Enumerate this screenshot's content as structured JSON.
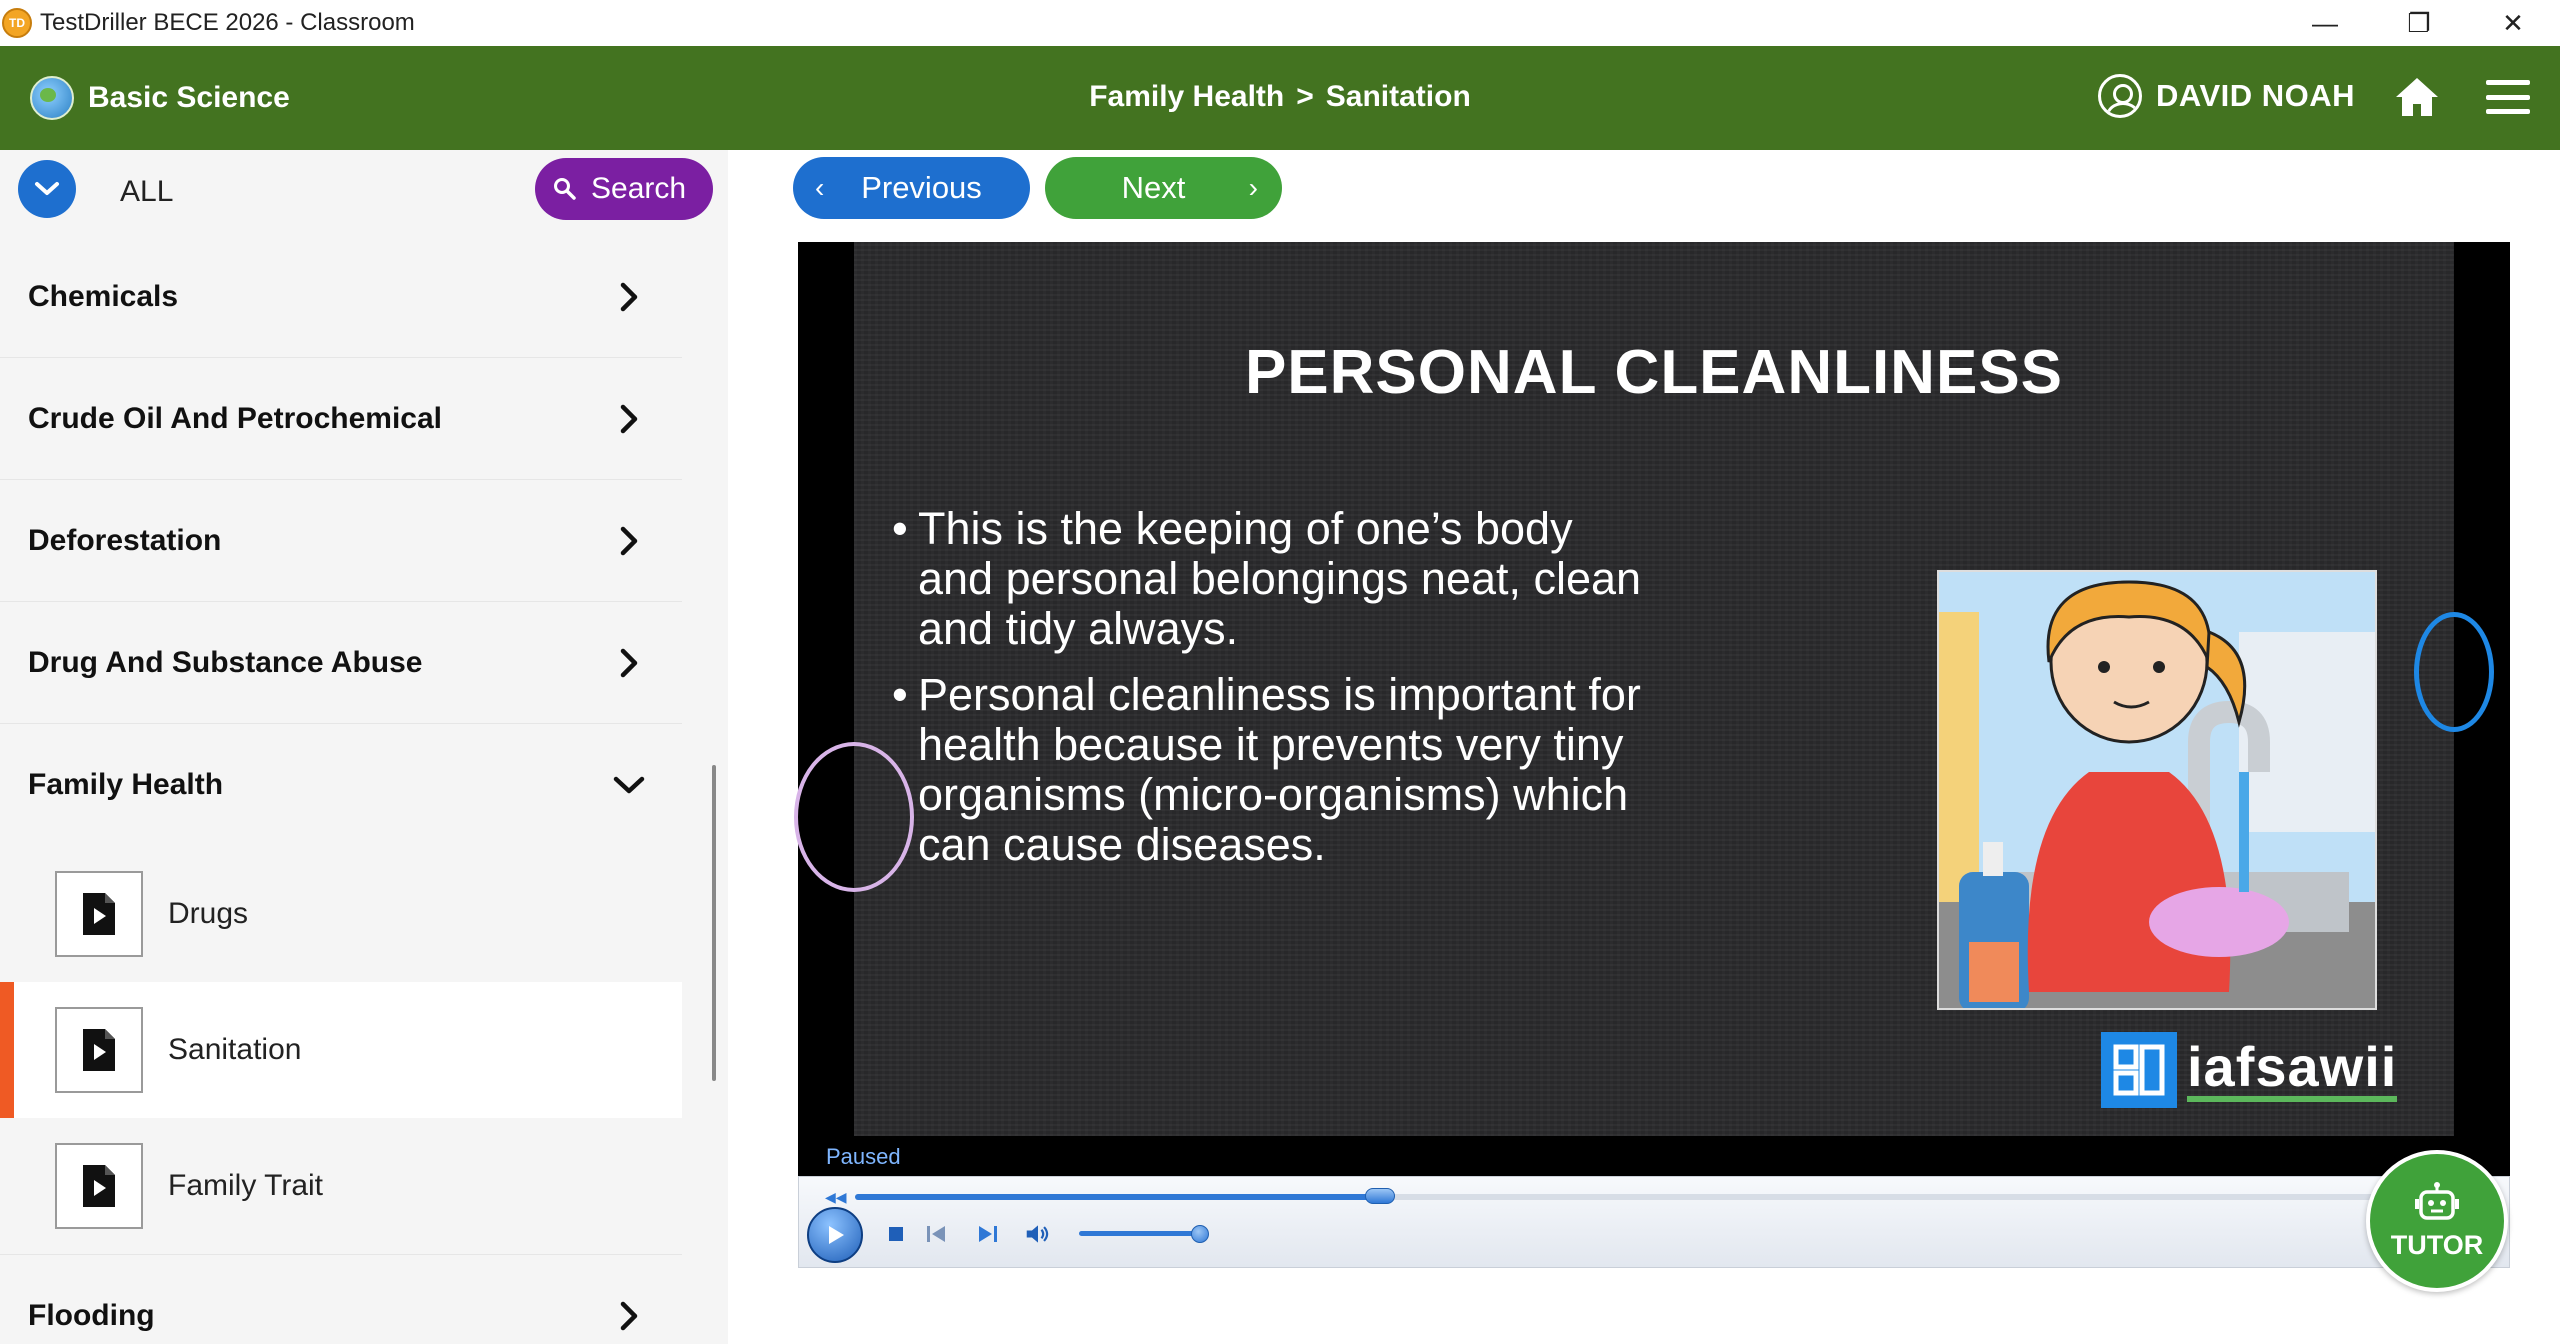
{
  "window": {
    "title": "TestDriller BECE 2026 - Classroom",
    "icon_text": "TD",
    "controls": {
      "minimize": "—",
      "restore": "❐",
      "close": "✕"
    }
  },
  "header": {
    "subject": "Basic Science",
    "breadcrumb": {
      "topic": "Family Health",
      "separator": ">",
      "lesson": "Sanitation"
    },
    "user_name": "DAVID NOAH",
    "brand_color": "#437320"
  },
  "sidebar": {
    "filter_label": "ALL",
    "search_label": "Search",
    "topics": [
      {
        "label": "Chemicals",
        "expanded": false
      },
      {
        "label": "Crude Oil And Petrochemical",
        "expanded": false
      },
      {
        "label": "Deforestation",
        "expanded": false
      },
      {
        "label": "Drug And Substance Abuse",
        "expanded": false
      },
      {
        "label": "Family Health",
        "expanded": true
      },
      {
        "label": "Flooding",
        "expanded": false
      }
    ],
    "lessons": [
      {
        "label": "Drugs",
        "active": false
      },
      {
        "label": "Sanitation",
        "active": true
      },
      {
        "label": "Family Trait",
        "active": false
      }
    ],
    "active_color": "#ef5a24"
  },
  "nav": {
    "previous_label": "Previous",
    "next_label": "Next"
  },
  "video": {
    "slide_title": "PERSONAL CLEANLINESS",
    "bullets": [
      "This is the keeping of one’s body and personal belongings neat, clean and tidy always.",
      "Personal cleanliness is important for health because it prevents very tiny organisms (micro-organisms) which can cause diseases."
    ],
    "brand_text": "iafsawii",
    "status": "Paused",
    "seek_fraction": 0.32,
    "volume_fraction": 0.9
  },
  "tutor": {
    "label": "TUTOR"
  }
}
